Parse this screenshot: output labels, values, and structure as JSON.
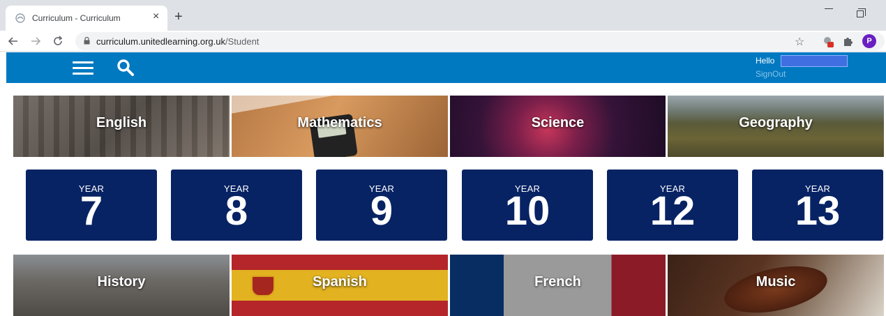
{
  "browser": {
    "tab_title": "Curriculum - Curriculum",
    "tab_close": "×",
    "new_tab": "+",
    "url_domain": "curriculum.unitedlearning.org.uk",
    "url_path": "/Student",
    "profile_initial": "P"
  },
  "header": {
    "hello": "Hello",
    "signout": "SignOut",
    "bg_color": "#0079c1"
  },
  "subjects_row1": [
    {
      "label": "English"
    },
    {
      "label": "Mathematics"
    },
    {
      "label": "Science"
    },
    {
      "label": "Geography"
    }
  ],
  "years": [
    {
      "prefix": "YEAR",
      "number": "7"
    },
    {
      "prefix": "YEAR",
      "number": "8"
    },
    {
      "prefix": "YEAR",
      "number": "9"
    },
    {
      "prefix": "YEAR",
      "number": "10"
    },
    {
      "prefix": "YEAR",
      "number": "12"
    },
    {
      "prefix": "YEAR",
      "number": "13"
    }
  ],
  "subjects_row2": [
    {
      "label": "History"
    },
    {
      "label": "Spanish"
    },
    {
      "label": "French"
    },
    {
      "label": "Music"
    }
  ],
  "colors": {
    "year_tile": "#072364",
    "header": "#0079c1"
  }
}
